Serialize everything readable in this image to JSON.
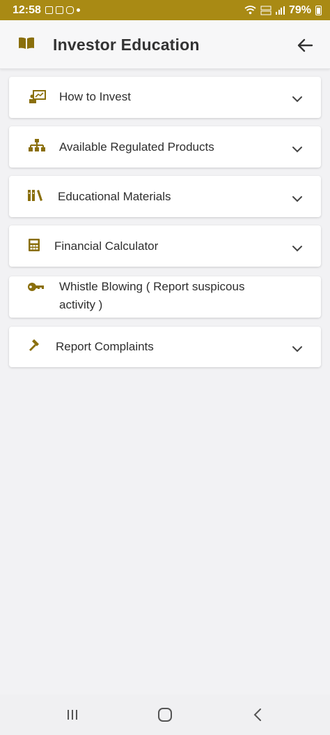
{
  "status_bar": {
    "time": "12:58",
    "battery": "79%",
    "icons": [
      "notification-icon",
      "message-icon",
      "teams-icon",
      "wifi-icon",
      "volte-icon",
      "signal-icon",
      "battery-icon"
    ]
  },
  "app_bar": {
    "title": "Investor Education",
    "icon": "book-icon",
    "back_icon": "arrow-left-icon"
  },
  "items": [
    {
      "label": "How to Invest",
      "icon": "presentation-chart-icon",
      "expandable": true
    },
    {
      "label": "Available Regulated Products",
      "icon": "sitemap-icon",
      "expandable": true
    },
    {
      "label": "Educational Materials",
      "icon": "books-icon",
      "expandable": true
    },
    {
      "label": "Financial Calculator",
      "icon": "calculator-icon",
      "expandable": true
    },
    {
      "label_line1": "Whistle Blowing ( Report suspicous",
      "label_line2": "activity )",
      "icon": "key-icon",
      "expandable": false
    },
    {
      "label": "Report Complaints",
      "icon": "gavel-icon",
      "expandable": true
    }
  ],
  "colors": {
    "accent": "#a98a14",
    "icon": "#8a6f0c",
    "background": "#f2f2f4",
    "card": "#ffffff",
    "text": "#2e2e2e"
  },
  "nav_bar": {
    "icons": [
      "recent-apps-icon",
      "home-icon",
      "back-icon"
    ]
  }
}
